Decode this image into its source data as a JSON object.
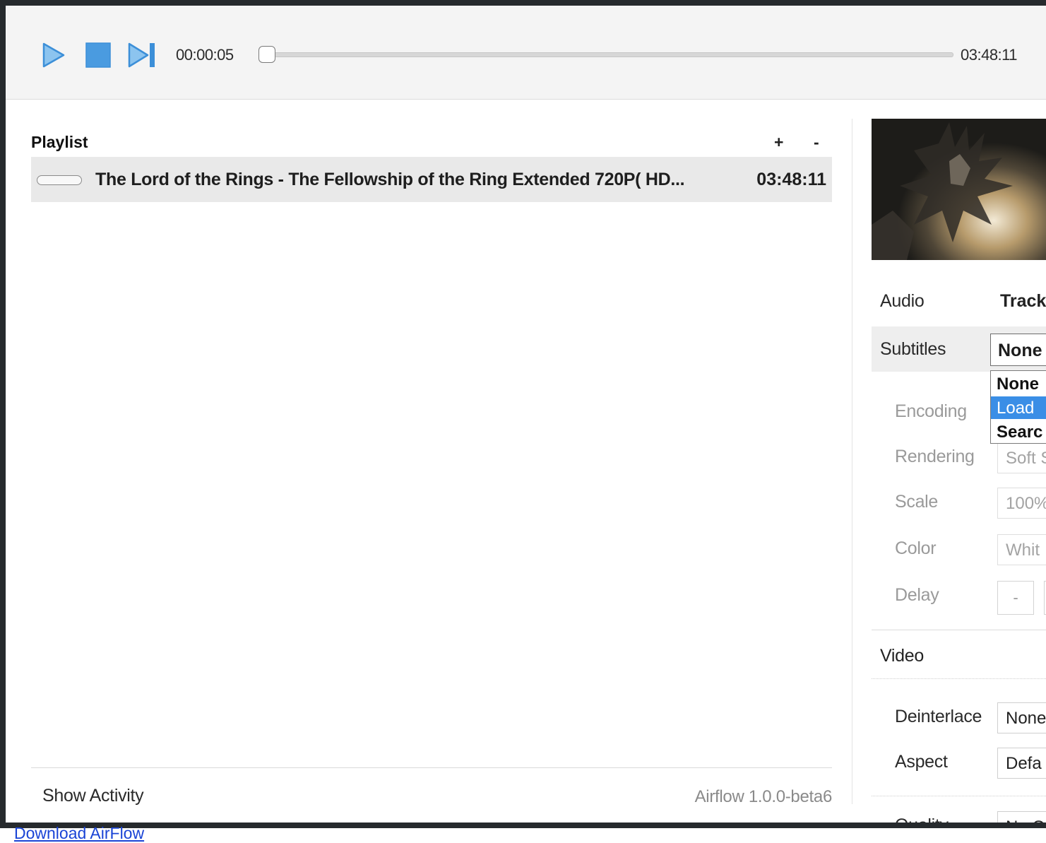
{
  "transport": {
    "current_time": "00:00:05",
    "total_time": "03:48:11",
    "progress": 0.0004,
    "accent_color": "#4a9be0"
  },
  "playlist": {
    "title": "Playlist",
    "add_label": "+",
    "remove_label": "-",
    "items": [
      {
        "title": "The Lord of the Rings - The Fellowship of the Ring Extended 720P( HD...",
        "duration": "03:48:11"
      }
    ],
    "show_activity": "Show Activity",
    "version": "Airflow 1.0.0-beta6"
  },
  "side_panel": {
    "audio": {
      "label": "Audio",
      "value": "Track"
    },
    "subtitles": {
      "label": "Subtitles",
      "value": "None",
      "options": [
        "None",
        "Load",
        "Searc"
      ],
      "selected_option": "Load"
    },
    "encoding": {
      "label": "Encoding"
    },
    "rendering": {
      "label": "Rendering",
      "value": "Soft S"
    },
    "scale": {
      "label": "Scale",
      "value": "100%"
    },
    "color": {
      "label": "Color",
      "value": "Whit"
    },
    "delay": {
      "label": "Delay",
      "minus_label": "-"
    },
    "video": {
      "label": "Video"
    },
    "deinterlace": {
      "label": "Deinterlace",
      "value": "None"
    },
    "aspect": {
      "label": "Aspect",
      "value": "Defa"
    },
    "quality": {
      "label": "Quality",
      "value": "No C"
    }
  },
  "footer": {
    "text": "Download AirFlow"
  }
}
